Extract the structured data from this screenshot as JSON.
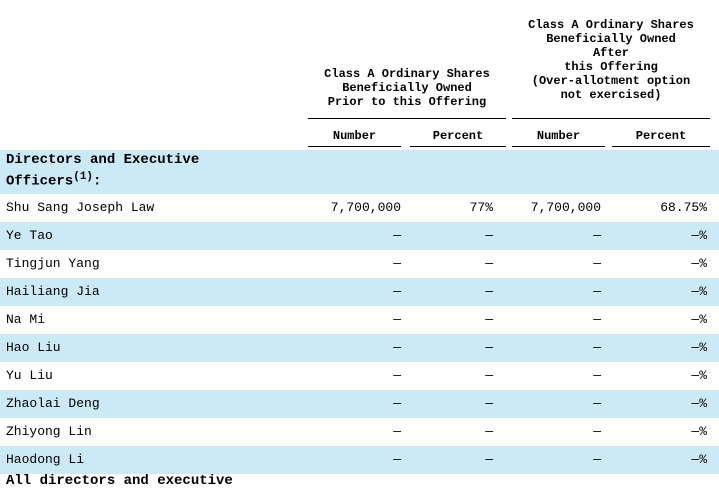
{
  "header": {
    "prior": "Class A Ordinary Shares\nBeneficially Owned\nPrior to this Offering",
    "after": "Class A Ordinary Shares\nBeneficially Owned\nAfter\nthis Offering\n(Over-allotment option\nnot exercised)",
    "sub": [
      "Number",
      "Percent",
      "Number",
      "Percent"
    ]
  },
  "section": {
    "title": "Directors and Executive\nOfficers",
    "footnote": "(1)",
    "suffix": ":"
  },
  "rows": [
    {
      "name": "Shu Sang Joseph Law",
      "n1": "7,700,000",
      "p1": "77%",
      "n2": "7,700,000",
      "p2": "68.75%"
    },
    {
      "name": "Ye Tao",
      "n1": "—",
      "p1": "—",
      "n2": "—",
      "p2": "—%"
    },
    {
      "name": "Tingjun Yang",
      "n1": "—",
      "p1": "—",
      "n2": "—",
      "p2": "—%"
    },
    {
      "name": "Hailiang Jia",
      "n1": "—",
      "p1": "—",
      "n2": "—",
      "p2": "—%"
    },
    {
      "name": "Na Mi",
      "n1": "—",
      "p1": "—",
      "n2": "—",
      "p2": "—%"
    },
    {
      "name": "Hao Liu",
      "n1": "—",
      "p1": "—",
      "n2": "—",
      "p2": "—%"
    },
    {
      "name": "Yu Liu",
      "n1": "—",
      "p1": "—",
      "n2": "—",
      "p2": "—%"
    },
    {
      "name": "Zhaolai Deng",
      "n1": "—",
      "p1": "—",
      "n2": "—",
      "p2": "—%"
    },
    {
      "name": "Zhiyong Lin",
      "n1": "—",
      "p1": "—",
      "n2": "—",
      "p2": "—%"
    },
    {
      "name": "Haodong Li",
      "n1": "—",
      "p1": "—",
      "n2": "—",
      "p2": "—%"
    }
  ],
  "cut_off_text": "All directors and executive",
  "colors": {
    "row_shade": "#cce9f8"
  }
}
